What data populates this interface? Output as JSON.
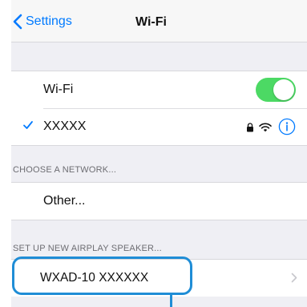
{
  "navbar": {
    "back_label": "Settings",
    "title": "Wi-Fi"
  },
  "wifi": {
    "label": "Wi-Fi",
    "enabled": true,
    "toggle_color": "#4cd964"
  },
  "connected_network": {
    "name": "XXXXX",
    "icons": [
      "lock-icon",
      "wifi-signal-icon",
      "info-icon"
    ]
  },
  "choose_network": {
    "header": "CHOOSE A NETWORK...",
    "other_label": "Other..."
  },
  "airplay": {
    "header": "SET UP NEW AIRPLAY SPEAKER...",
    "speaker_name": "WXAD-10 XXXXXX"
  },
  "colors": {
    "accent": "#007aff",
    "callout": "#1f8dd6"
  }
}
